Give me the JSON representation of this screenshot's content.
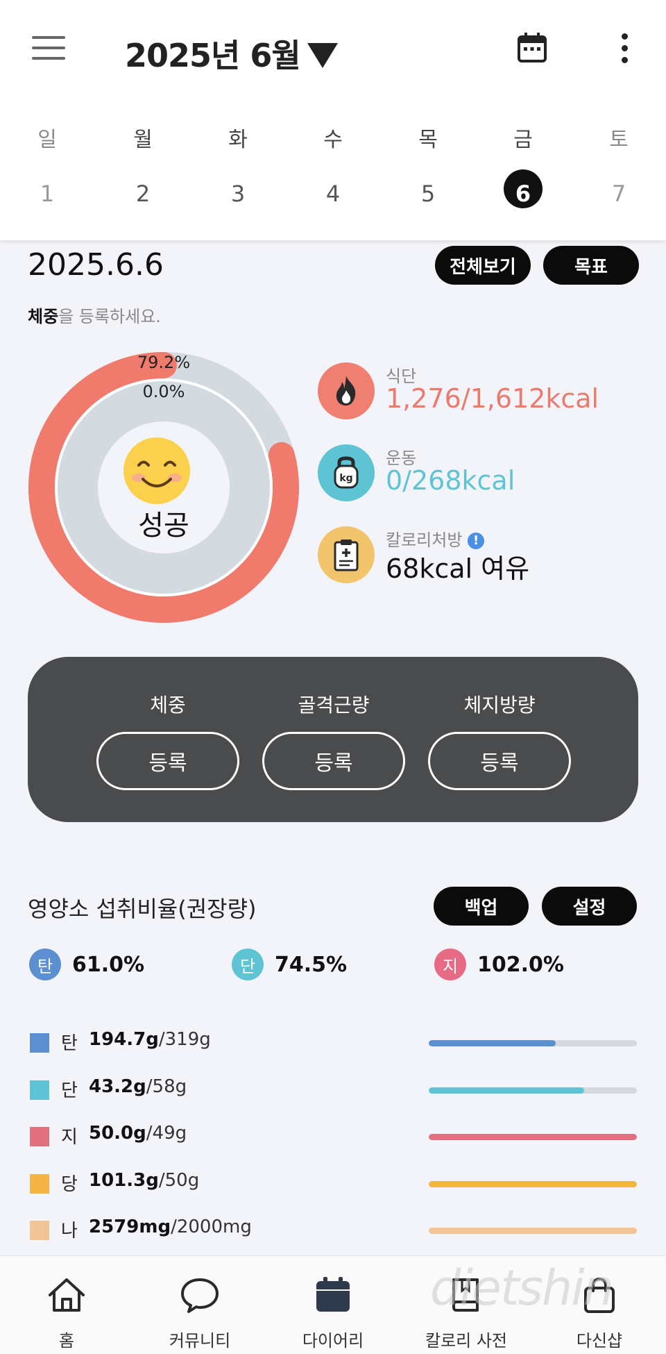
{
  "header": {
    "month_title": "2025년 6월",
    "weekdays": [
      "일",
      "월",
      "화",
      "수",
      "목",
      "금",
      "토"
    ],
    "dates": [
      "1",
      "2",
      "3",
      "4",
      "5",
      "6",
      "7"
    ],
    "selected_date": "6"
  },
  "day": {
    "date_label": "2025.6.6",
    "view_all_label": "전체보기",
    "goal_label": "목표",
    "weight_hint_bold": "체중",
    "weight_hint_rest": "을 등록하세요."
  },
  "ring": {
    "outer_pct_label": "79.2%",
    "inner_pct_label": "0.0%",
    "outer_fraction": 0.792,
    "inner_fraction": 0.0,
    "status_label": "성공",
    "outer_color": "#f07b6c",
    "track_color": "#d3dbe1"
  },
  "stats": [
    {
      "label": "식단",
      "value": "1,276/1,612kcal",
      "color": "#ea7a6d",
      "circle": "#ef7f70",
      "icon": "fire-icon"
    },
    {
      "label": "운동",
      "value": "0/268kcal",
      "color": "#5ec4d4",
      "circle": "#5ec4d4",
      "icon": "kettlebell-icon"
    },
    {
      "label": "칼로리처방",
      "value": "68kcal 여유",
      "color": "#111111",
      "circle": "#f2c46b",
      "icon": "clipboard-icon"
    }
  ],
  "body_card": {
    "columns": [
      {
        "title": "체중",
        "button": "등록"
      },
      {
        "title": "골격근량",
        "button": "등록"
      },
      {
        "title": "체지방량",
        "button": "등록"
      }
    ]
  },
  "nutrition": {
    "title": "영양소 섭취비율(권장량)",
    "backup_label": "백업",
    "settings_label": "설정",
    "ratios": [
      {
        "badge": "탄",
        "value": "61.0%",
        "color": "#5b8fd0"
      },
      {
        "badge": "단",
        "value": "74.5%",
        "color": "#5ec4d4"
      },
      {
        "badge": "지",
        "value": "102.0%",
        "color": "#e86b86"
      }
    ],
    "rows": [
      {
        "name": "탄",
        "amount": "194.7g",
        "target": "/319g",
        "fraction": 0.61,
        "color": "#5b8fd0"
      },
      {
        "name": "단",
        "amount": "43.2g",
        "target": "/58g",
        "fraction": 0.745,
        "color": "#5ec4d4"
      },
      {
        "name": "지",
        "amount": "50.0g",
        "target": "/49g",
        "fraction": 1.0,
        "color": "#e07080"
      },
      {
        "name": "당",
        "amount": "101.3g",
        "target": "/50g",
        "fraction": 1.0,
        "color": "#f4b345"
      },
      {
        "name": "나",
        "amount": "2579mg",
        "target": "/2000mg",
        "fraction": 1.0,
        "color": "#f1c497"
      }
    ]
  },
  "bottom_nav": [
    {
      "label": "홈",
      "icon": "home-icon"
    },
    {
      "label": "커뮤니티",
      "icon": "chat-bubble-icon"
    },
    {
      "label": "다이어리",
      "icon": "diary-calendar-icon"
    },
    {
      "label": "칼로리 사전",
      "icon": "book-icon"
    },
    {
      "label": "다신샵",
      "icon": "shopping-bag-icon"
    }
  ]
}
